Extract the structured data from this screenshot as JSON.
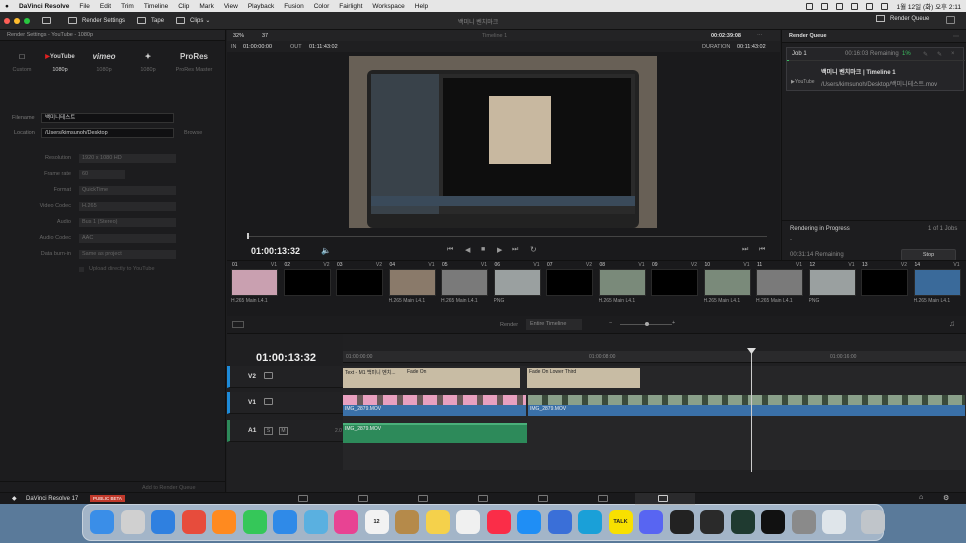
{
  "menubar": {
    "app": "DaVinci Resolve",
    "items": [
      "File",
      "Edit",
      "Trim",
      "Timeline",
      "Clip",
      "Mark",
      "View",
      "Playback",
      "Fusion",
      "Color",
      "Fairlight",
      "Workspace",
      "Help"
    ],
    "clock": "1월 12일 (화) 오후 2:11"
  },
  "toolbar": {
    "render_settings": "Render Settings",
    "tape": "Tape",
    "clips": "Clips",
    "project_title": "백미니 벤치마크",
    "render_queue": "Render Queue"
  },
  "render_settings": {
    "header": "Render Settings - YouTube - 1080p",
    "presets": [
      {
        "logo": "",
        "label": "Custom"
      },
      {
        "logo": "YouTube",
        "label": "1080p"
      },
      {
        "logo": "vimeo",
        "label": "1080p"
      },
      {
        "logo": "",
        "label": "1080p"
      },
      {
        "logo": "ProRes",
        "label": "ProRes Master"
      }
    ],
    "filename_label": "Filename",
    "filename": "백미니테스트",
    "location_label": "Location",
    "location": "/Users/kimsunoh/Desktop",
    "browse": "Browse",
    "fields": [
      {
        "k": "Resolution",
        "v": "1920 x 1080 HD"
      },
      {
        "k": "Frame rate",
        "v": "60"
      },
      {
        "k": "Format",
        "v": "QuickTime"
      },
      {
        "k": "Video Codec",
        "v": "H.265"
      },
      {
        "k": "Audio",
        "v": "Bus 1 (Stereo)"
      },
      {
        "k": "Audio Codec",
        "v": "AAC"
      },
      {
        "k": "Data burn-in",
        "v": "Same as project"
      }
    ],
    "upload": "Upload directly to YouTube",
    "add_queue": "Add to Render Queue"
  },
  "viewer": {
    "zoom": "32%",
    "zoom2": "37",
    "timeline": "Timeline 1",
    "timecode": "00:02:39:08",
    "in_label": "IN",
    "in": "01:00:00:00",
    "out_label": "OUT",
    "out": "01:11:43:02",
    "duration_label": "DURATION",
    "duration": "00:11:43:02",
    "current": "01:00:13:32"
  },
  "render_queue": {
    "title": "Render Queue",
    "job": "Job 1",
    "remaining": "00:16:03 Remaining",
    "pct": "1%",
    "job_title": "백미니 벤치마크 | Timeline 1",
    "path": "/Users/kimsunoh/Desktop/백미니테스트.mov",
    "yt": "YouTube",
    "progress_label": "Rendering in Progress",
    "jobs_count": "1 of 1 Jobs",
    "elapsed": "00:31:14 Remaining",
    "stop": "Stop",
    "progress": 0.01
  },
  "clips": [
    {
      "n": "01",
      "t": "V1",
      "name": "H.265 Main L4.1",
      "c": "#c9a0b0"
    },
    {
      "n": "02",
      "t": "V2",
      "name": "",
      "c": "#000"
    },
    {
      "n": "03",
      "t": "V2",
      "name": "",
      "c": "#000"
    },
    {
      "n": "04",
      "t": "V1",
      "name": "H.265 Main L4.1",
      "c": "#8a7a6a"
    },
    {
      "n": "05",
      "t": "V1",
      "name": "H.265 Main L4.1",
      "c": "#7a7a7a"
    },
    {
      "n": "06",
      "t": "V1",
      "name": "PNG",
      "c": "#9aa0a0"
    },
    {
      "n": "07",
      "t": "V2",
      "name": "",
      "c": "#000"
    },
    {
      "n": "08",
      "t": "V1",
      "name": "H.265 Main L4.1",
      "c": "#7a8a7a"
    },
    {
      "n": "09",
      "t": "V2",
      "name": "",
      "c": "#000"
    },
    {
      "n": "10",
      "t": "V1",
      "name": "H.265 Main L4.1",
      "c": "#7a8a7a"
    },
    {
      "n": "11",
      "t": "V1",
      "name": "H.265 Main L4.1",
      "c": "#7a7a7a"
    },
    {
      "n": "12",
      "t": "V1",
      "name": "PNG",
      "c": "#9aa0a0"
    },
    {
      "n": "13",
      "t": "V2",
      "name": "",
      "c": "#000"
    },
    {
      "n": "14",
      "t": "V1",
      "name": "H.265 Main L4.1",
      "c": "#3a6a9a"
    }
  ],
  "timeline": {
    "render_label": "Render",
    "render_mode": "Entire Timeline",
    "timecode": "01:00:13:32",
    "ruler": [
      "01:00:00:00",
      "01:00:08:00",
      "01:00:16:00"
    ],
    "tracks": [
      {
        "name": "V2"
      },
      {
        "name": "V1"
      },
      {
        "name": "A1",
        "s": "S",
        "m": "M",
        "db": "2.0"
      }
    ],
    "clips": {
      "text1": "Text - M1 백미니 벤치...",
      "fade1": "Fade On",
      "lower": "Fade On Lower Third",
      "v1a": "IMG_2879.MOV",
      "v1b": "IMG_2879.MOV",
      "a1": "IMG_2879.MOV"
    }
  },
  "pagebar": {
    "app": "DaVinci Resolve 17",
    "beta": "PUBLIC BETA"
  },
  "dock": [
    {
      "c": "#3a8ee8"
    },
    {
      "c": "#d0d0d0"
    },
    {
      "c": "#2f80e0"
    },
    {
      "c": "#e74c3c"
    },
    {
      "c": "#ff8a1f"
    },
    {
      "c": "#35c759"
    },
    {
      "c": "#2f8ae8"
    },
    {
      "c": "#5ab0e0"
    },
    {
      "c": "#e84393"
    },
    {
      "c": "#f2f2f2",
      "label": "12"
    },
    {
      "c": "#b58a4a"
    },
    {
      "c": "#f5d14b"
    },
    {
      "c": "#f0f0f0"
    },
    {
      "c": "#fa2d48"
    },
    {
      "c": "#1f8ef5"
    },
    {
      "c": "#3a6fd8"
    },
    {
      "c": "#1aa0d8"
    },
    {
      "c": "#f8e000",
      "label": "TALK"
    },
    {
      "c": "#5865f2"
    },
    {
      "c": "#222"
    },
    {
      "c": "#2a2a2a"
    },
    {
      "c": "#1f3a30"
    },
    {
      "c": "#111"
    },
    {
      "c": "#8a8a8a"
    },
    {
      "c": "#dfe5ea"
    },
    {
      "c": "#c0c5ca"
    }
  ],
  "colors": {
    "accent": "#e04040",
    "teal": "#2d8a5a",
    "blue": "#3a70a8"
  }
}
